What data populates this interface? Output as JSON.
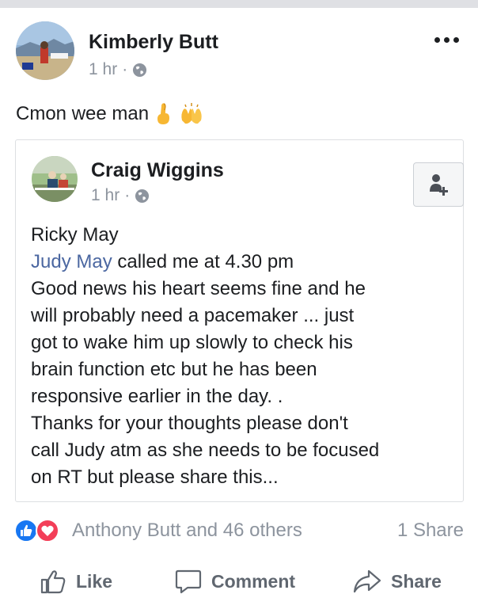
{
  "post": {
    "author": "Kimberly Butt",
    "time": "1 hr",
    "separator": "·",
    "text": "Cmon wee man",
    "emojis": [
      "fingers-crossed",
      "raised-hands"
    ]
  },
  "shared_post": {
    "author": "Craig Wiggins",
    "time": "1 hr",
    "separator": "·",
    "lines": [
      "Ricky May",
      "called me at 4.30 pm",
      "Good news his heart seems fine and he",
      "will probably need a pacemaker ... just",
      "got to wake him up slowly to check his",
      "brain function etc but he has been",
      "responsive earlier in the day. .",
      "Thanks for your thoughts please don't",
      "call Judy atm as she needs to be focused",
      "on RT but please share this..."
    ],
    "mention": "Judy May"
  },
  "reactions": {
    "summary": "Anthony Butt and 46 others",
    "shares": "1 Share",
    "types": [
      "like",
      "love"
    ]
  },
  "actions": {
    "like": "Like",
    "comment": "Comment",
    "share": "Share"
  },
  "colors": {
    "text": "#1c1e21",
    "meta": "#8d949e",
    "mention": "#4b67a1",
    "like_blue": "#1877f2",
    "love_red": "#f33e58",
    "action_gray": "#606770"
  }
}
